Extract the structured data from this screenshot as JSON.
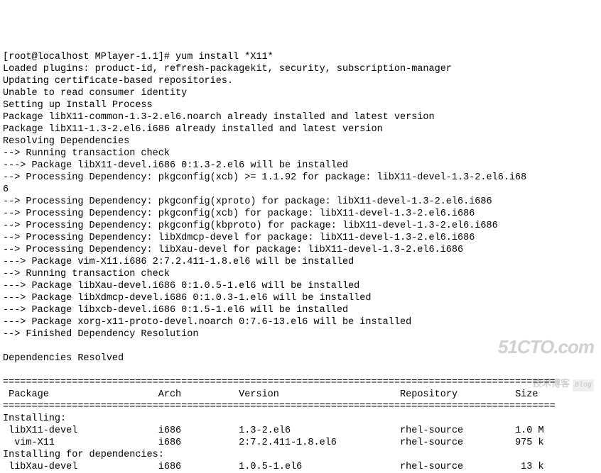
{
  "prompt": "[root@localhost MPlayer-1.1]# ",
  "command": "yum install *X11*",
  "lines": [
    "Loaded plugins: product-id, refresh-packagekit, security, subscription-manager",
    "Updating certificate-based repositories.",
    "Unable to read consumer identity",
    "Setting up Install Process",
    "Package libX11-common-1.3-2.el6.noarch already installed and latest version",
    "Package libX11-1.3-2.el6.i686 already installed and latest version",
    "Resolving Dependencies",
    "--> Running transaction check",
    "---> Package libX11-devel.i686 0:1.3-2.el6 will be installed",
    "--> Processing Dependency: pkgconfig(xcb) >= 1.1.92 for package: libX11-devel-1.3-2.el6.i68",
    "6",
    "--> Processing Dependency: pkgconfig(xproto) for package: libX11-devel-1.3-2.el6.i686",
    "--> Processing Dependency: pkgconfig(xcb) for package: libX11-devel-1.3-2.el6.i686",
    "--> Processing Dependency: pkgconfig(kbproto) for package: libX11-devel-1.3-2.el6.i686",
    "--> Processing Dependency: libXdmcp-devel for package: libX11-devel-1.3-2.el6.i686",
    "--> Processing Dependency: libXau-devel for package: libX11-devel-1.3-2.el6.i686",
    "---> Package vim-X11.i686 2:7.2.411-1.8.el6 will be installed",
    "--> Running transaction check",
    "---> Package libXau-devel.i686 0:1.0.5-1.el6 will be installed",
    "---> Package libXdmcp-devel.i686 0:1.0.3-1.el6 will be installed",
    "---> Package libxcb-devel.i686 0:1.5-1.el6 will be installed",
    "---> Package xorg-x11-proto-devel.noarch 0:7.6-13.el6 will be installed",
    "--> Finished Dependency Resolution",
    "",
    "Dependencies Resolved",
    ""
  ],
  "separator": "================================================================================================",
  "table_header": {
    "package": " Package",
    "arch": "Arch",
    "version": "Version",
    "repository": "Repository",
    "size": "Size"
  },
  "installing_label": "Installing:",
  "installing_deps_label": "Installing for dependencies:",
  "packages_install": [
    {
      "name": " libX11-devel",
      "arch": "i686",
      "version": "1.3-2.el6",
      "repo": "rhel-source",
      "size": "1.0 M"
    },
    {
      "name": "  vim-X11",
      "arch": "i686",
      "version": "2:7.2.411-1.8.el6",
      "repo": "rhel-source",
      "size": "975 k"
    }
  ],
  "packages_deps": [
    {
      "name": " libXau-devel",
      "arch": "i686",
      "version": "1.0.5-1.el6",
      "repo": "rhel-source",
      "size": "13 k"
    }
  ],
  "watermark": {
    "main": "51CTO.com",
    "sub": "技术博客",
    "blog": "Blog"
  }
}
